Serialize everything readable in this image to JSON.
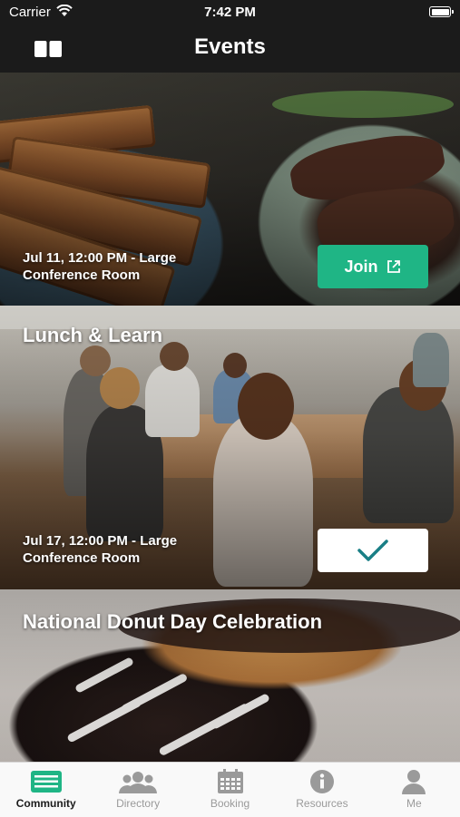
{
  "status_bar": {
    "carrier": "Carrier",
    "time": "7:42 PM"
  },
  "nav": {
    "title": "Events"
  },
  "events": [
    {
      "title": "",
      "meta": "Jul 11, 12:00 PM - Large Conference Room",
      "action": "Join",
      "state": "join"
    },
    {
      "title": "Lunch & Learn",
      "meta": "Jul 17, 12:00 PM - Large Conference Room",
      "action": "",
      "state": "joined"
    },
    {
      "title": "National Donut Day Celebration",
      "meta": "",
      "action": "",
      "state": ""
    }
  ],
  "colors": {
    "accent": "#1fb585",
    "bar": "#1b1b1b",
    "active_tab_icon": "#1fb585",
    "inactive_tab": "#9a9a9a"
  },
  "tabs": [
    {
      "label": "Community",
      "icon": "community-icon",
      "active": true
    },
    {
      "label": "Directory",
      "icon": "directory-icon",
      "active": false
    },
    {
      "label": "Booking",
      "icon": "calendar-icon",
      "active": false
    },
    {
      "label": "Resources",
      "icon": "info-icon",
      "active": false
    },
    {
      "label": "Me",
      "icon": "person-icon",
      "active": false
    }
  ]
}
